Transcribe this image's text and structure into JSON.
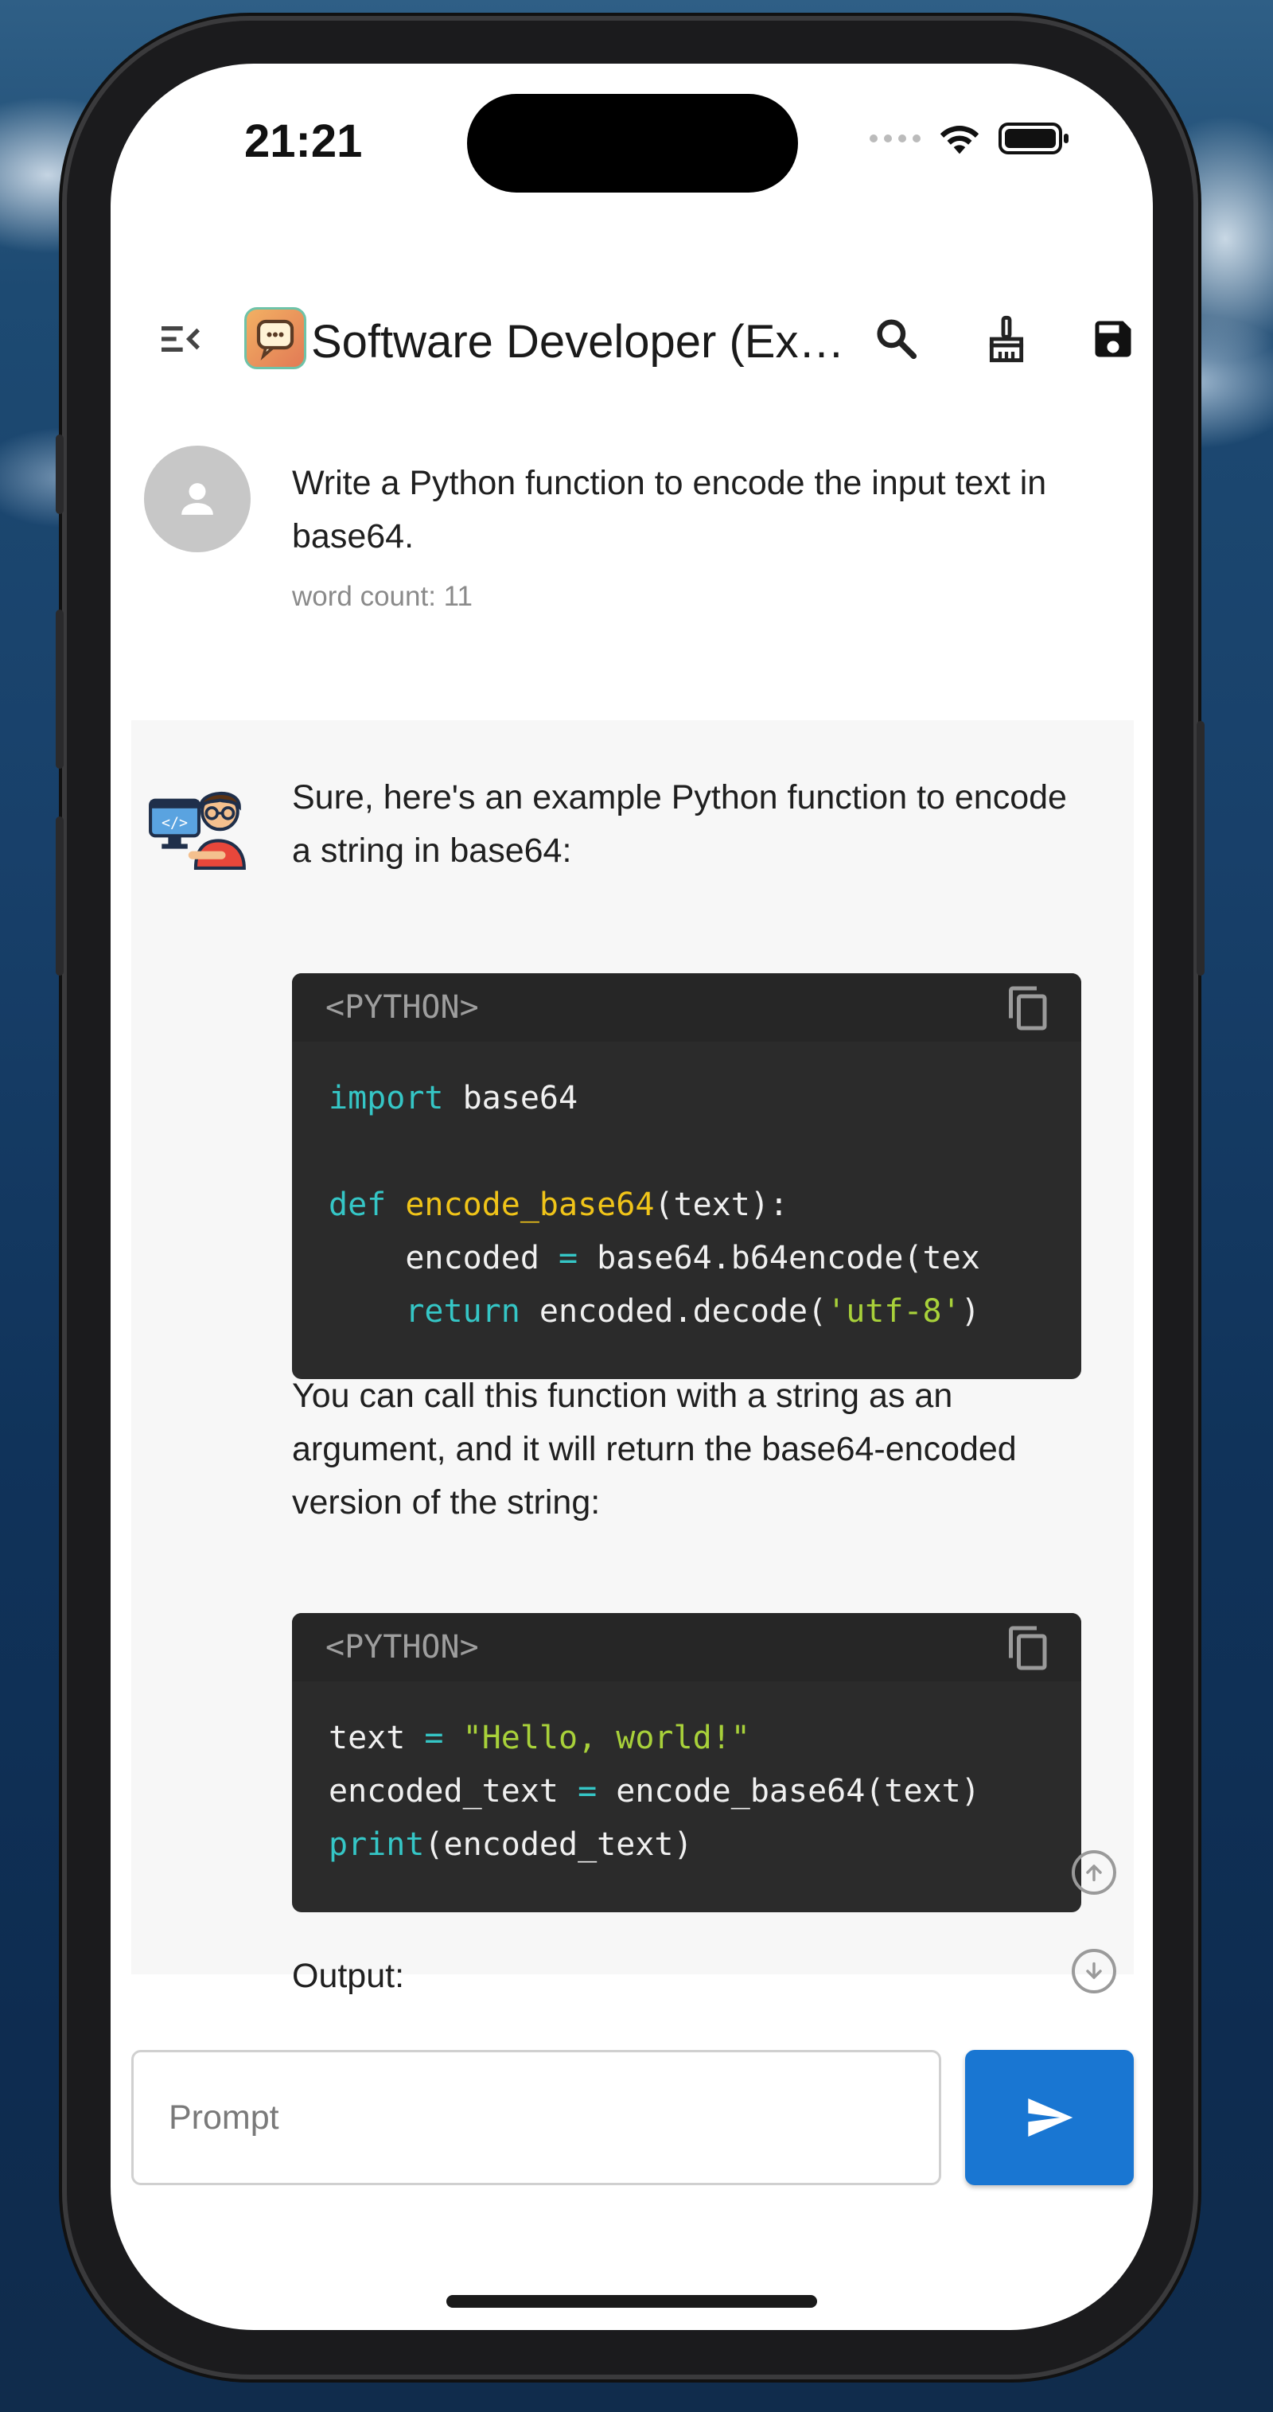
{
  "status_bar": {
    "time": "21:21"
  },
  "app_bar": {
    "title": "Software Developer (Ex…",
    "icons": [
      "menu-open-icon",
      "app-logo",
      "search-icon",
      "broom-icon",
      "save-icon"
    ]
  },
  "user_message": {
    "text": "Write a Python function to encode the input text in base64.",
    "word_count": "word count: 11"
  },
  "bot_message": {
    "intro": "Sure, here's an example Python function to encode a string in base64:",
    "code_block_1": {
      "language": "<PYTHON>",
      "lines": [
        [
          {
            "t": "import",
            "c": "kw"
          },
          {
            "t": " base64",
            "c": ""
          }
        ],
        [],
        [
          {
            "t": "def",
            "c": "kw"
          },
          {
            "t": " ",
            "c": ""
          },
          {
            "t": "encode_base64",
            "c": "fn"
          },
          {
            "t": "(text):",
            "c": ""
          }
        ],
        [
          {
            "t": "    encoded ",
            "c": ""
          },
          {
            "t": "=",
            "c": "kw"
          },
          {
            "t": " base64.b64encode(tex",
            "c": ""
          }
        ],
        [
          {
            "t": "    ",
            "c": ""
          },
          {
            "t": "return",
            "c": "kw"
          },
          {
            "t": " encoded.decode(",
            "c": ""
          },
          {
            "t": "'utf-8'",
            "c": "st"
          },
          {
            "t": ")",
            "c": ""
          }
        ]
      ]
    },
    "middle": "You can call this function with a string as an argument, and it will return the base64-encoded version of the string:",
    "code_block_2": {
      "language": "<PYTHON>",
      "lines": [
        [
          {
            "t": "text ",
            "c": ""
          },
          {
            "t": "=",
            "c": "kw"
          },
          {
            "t": " ",
            "c": ""
          },
          {
            "t": "\"Hello, world!\"",
            "c": "st"
          }
        ],
        [
          {
            "t": "encoded_text ",
            "c": ""
          },
          {
            "t": "=",
            "c": "kw"
          },
          {
            "t": " encode_base64(text)",
            "c": ""
          }
        ],
        [
          {
            "t": "print",
            "c": "kw"
          },
          {
            "t": "(encoded_text)",
            "c": ""
          }
        ]
      ]
    },
    "output_label": "Output:"
  },
  "input": {
    "placeholder": "Prompt",
    "value": ""
  },
  "colors": {
    "send_button": "#1976d2",
    "keyword": "#35c6c6",
    "function": "#f0c419",
    "string": "#a8d13a"
  }
}
